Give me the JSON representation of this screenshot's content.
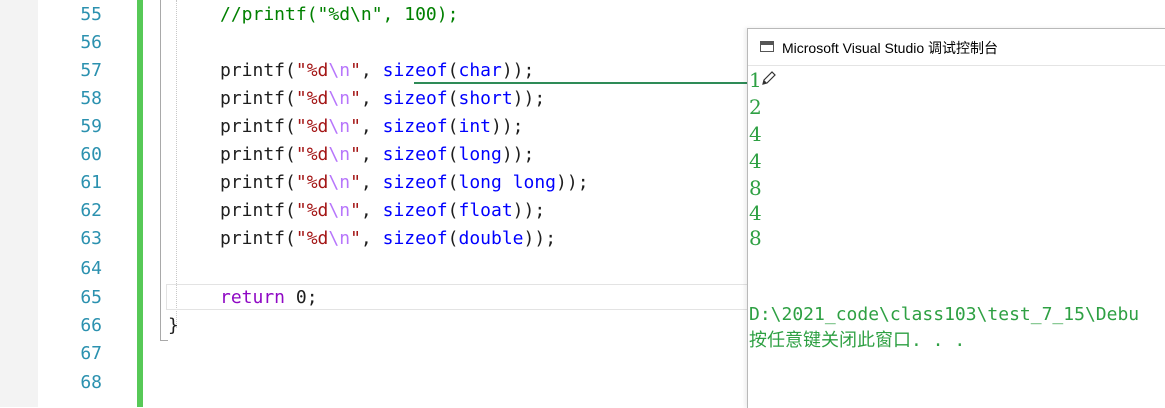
{
  "editor": {
    "line_numbers": [
      "55",
      "56",
      "57",
      "58",
      "59",
      "60",
      "61",
      "62",
      "63",
      "64",
      "65",
      "66",
      "67",
      "68"
    ],
    "code": {
      "l55": "//printf(\"%d\\n\", 100);",
      "printf": "printf",
      "open": "(",
      "q1": "\"%d",
      "esc": "\\n",
      "q2": "\"",
      "comma": ", ",
      "sizeof": "sizeof",
      "close2": "));",
      "types": [
        "char",
        "short",
        "int",
        "long",
        "long long",
        "float",
        "double"
      ],
      "return_kw": "return",
      "return_val": "0",
      "semicolon": ";",
      "close_brace": "}"
    }
  },
  "console": {
    "title": "Microsoft Visual Studio 调试控制台",
    "outputs": [
      "1",
      "2",
      "4",
      "4",
      "8",
      "4",
      "8"
    ],
    "path": "D:\\2021_code\\class103\\test_7_15\\Debu",
    "prompt": "按任意键关闭此窗口. . ."
  },
  "colors": {
    "line_number": "#2b91af",
    "keyword": "#0000ff",
    "control_keyword": "#8f08c4",
    "string": "#a31515",
    "escape": "#b776fb",
    "comment": "#008000",
    "console_text": "#2ea043",
    "change_bar": "#57c957"
  },
  "icons": [
    "console-app-icon",
    "pencil-cursor-icon"
  ]
}
